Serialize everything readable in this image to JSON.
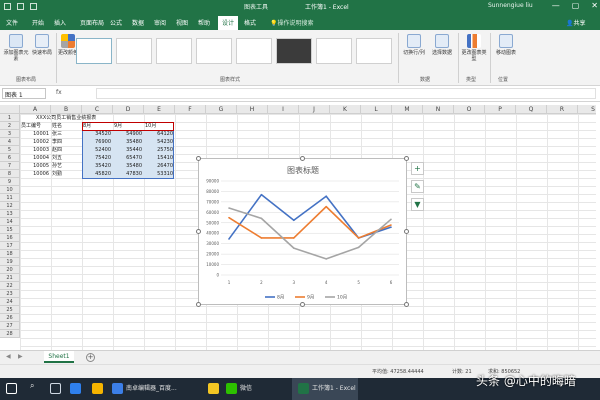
{
  "window": {
    "context_tab": "图表工具",
    "title": "工作簿1 - Excel",
    "user": "Sunnengiue liu",
    "controls": [
      "—",
      "▢",
      "✕"
    ]
  },
  "ribbon_tabs": [
    "文件",
    "开始",
    "插入",
    "页面布局",
    "公式",
    "数据",
    "审阅",
    "视图",
    "帮助",
    "设计",
    "格式"
  ],
  "ribbon_active": "设计",
  "tell_me": "操作说明搜索",
  "share": "共享",
  "ribbon": {
    "add_element": "添加图表元素",
    "quick_layout": "快速布局",
    "change_colors": "更改颜色",
    "switch_row_col": "切换行/列",
    "select_data": "选择数据",
    "change_type": "更改图表类型",
    "move_chart": "移动图表",
    "groups": {
      "layouts": "图表布局",
      "styles": "图表样式",
      "data": "数据",
      "type": "类型",
      "location": "位置"
    }
  },
  "formula_bar": {
    "name_box": "图表 1",
    "fx": "fx",
    "value": ""
  },
  "columns": [
    "A",
    "B",
    "C",
    "D",
    "E",
    "F",
    "G",
    "H",
    "I",
    "J",
    "K",
    "L",
    "M",
    "N",
    "O",
    "P",
    "Q",
    "R",
    "S"
  ],
  "rows": [
    "1",
    "2",
    "3",
    "4",
    "5",
    "6",
    "7",
    "8",
    "9",
    "10",
    "11",
    "12",
    "13",
    "14",
    "15",
    "16",
    "17",
    "18",
    "19",
    "20",
    "21",
    "22",
    "23",
    "24",
    "25",
    "26",
    "27",
    "28"
  ],
  "sheet": {
    "title": "XXX公司员工销售业绩报表",
    "headers": [
      "员工编号",
      "姓名",
      "8月",
      "9月",
      "10月"
    ],
    "data": [
      [
        "10001",
        "张三",
        "34520",
        "54900",
        "64120"
      ],
      [
        "10002",
        "李四",
        "76900",
        "35480",
        "54230"
      ],
      [
        "10003",
        "赵四",
        "52400",
        "35440",
        "25750"
      ],
      [
        "10004",
        "刘五",
        "75420",
        "65470",
        "15410"
      ],
      [
        "10005",
        "孙艺",
        "35420",
        "35480",
        "26470"
      ],
      [
        "10006",
        "刘勤",
        "45820",
        "47830",
        "53310"
      ]
    ]
  },
  "chart_data": {
    "type": "line",
    "title": "图表标题",
    "categories": [
      "1",
      "2",
      "3",
      "4",
      "5",
      "6"
    ],
    "series": [
      {
        "name": "8月",
        "values": [
          34520,
          76900,
          52400,
          75420,
          35420,
          45820
        ],
        "color": "#4472c4"
      },
      {
        "name": "9月",
        "values": [
          54900,
          35480,
          35440,
          65470,
          35480,
          47830
        ],
        "color": "#ed7d31"
      },
      {
        "name": "10月",
        "values": [
          64120,
          54230,
          25750,
          15410,
          26470,
          53310
        ],
        "color": "#a5a5a5"
      }
    ],
    "ylim": [
      0,
      90000
    ],
    "yticks": [
      "0",
      "10000",
      "20000",
      "30000",
      "40000",
      "50000",
      "60000",
      "70000",
      "80000",
      "90000"
    ],
    "grid": true,
    "legend": "bottom"
  },
  "chart_side_buttons": [
    "+",
    "✎",
    "▼"
  ],
  "sheet_tabs": [
    "Sheet1"
  ],
  "add_sheet": "+",
  "status": {
    "average": "平均值: 47258.44444",
    "count": "计数: 21",
    "sum": "求和: 850652"
  },
  "taskbar": {
    "search_icon": "search-icon",
    "items": [
      "南卓编辑器_百度...",
      "微信",
      "工作簿1 - Excel"
    ]
  },
  "watermark": "头条 @心中的晦暗"
}
